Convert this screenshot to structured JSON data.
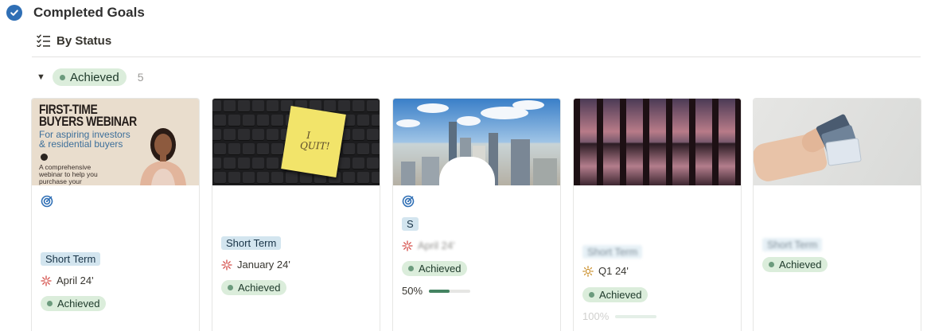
{
  "page": {
    "title": "Completed Goals"
  },
  "view": {
    "label": "By Status"
  },
  "group": {
    "label": "Achieved",
    "count": "5"
  },
  "colors": {
    "accent": "#2f6fb5",
    "achieved_bg": "#dbeddb",
    "achieved_dot": "#6c9b7d",
    "term_tag_bg": "#d3e5ef",
    "progress": "#448361"
  },
  "cards": [
    {
      "cover_text": {
        "title_line1": "FIRST-TIME",
        "title_line2": "BUYERS WEBINAR",
        "subtitle_line1": "For aspiring investors",
        "subtitle_line2": "& residential buyers",
        "desc_line1": "A comprehensive",
        "desc_line2": "webinar to help you",
        "desc_line3": "purchase your"
      },
      "icon": "target-icon",
      "term": "Short Term",
      "date_icon": "sparkle-icon",
      "date": "April 24'",
      "status": "Achieved"
    },
    {
      "cover_text": {
        "note_line1": "I",
        "note_line2": "QUIT!"
      },
      "term": "Short Term",
      "date_icon": "sparkle-icon",
      "date": "January 24'",
      "status": "Achieved"
    },
    {
      "icon": "target-icon",
      "term": "S",
      "date_icon": "sparkle-icon",
      "date": "April 24'",
      "status": "Achieved",
      "progress_label": "50%",
      "progress": 0.5
    },
    {
      "term": "Short Term",
      "date_icon": "sun-icon",
      "date": "Q1 24'",
      "status": "Achieved",
      "progress_label": "100%",
      "progress": 1.0
    },
    {
      "term": "Short Term",
      "status": "Achieved"
    }
  ]
}
